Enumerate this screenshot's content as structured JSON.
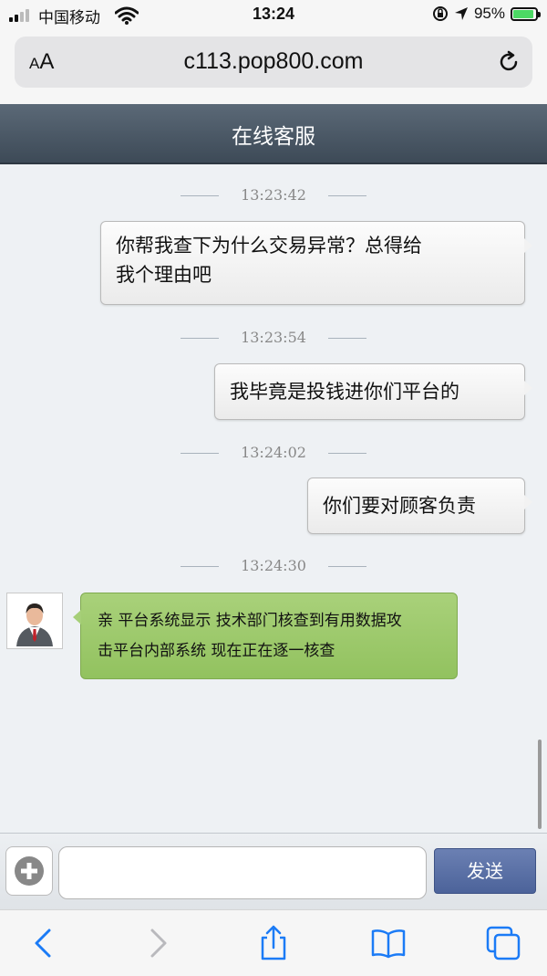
{
  "status_bar": {
    "carrier": "中国移动",
    "time": "13:24",
    "battery": "95%"
  },
  "browser": {
    "text_size_label_small": "A",
    "text_size_label_big": "A",
    "url": "c113.pop800.com"
  },
  "header": {
    "title": "在线客服"
  },
  "messages": [
    {
      "time": "13:23:42",
      "text_line1": "你帮我查下为什么交易异常？总得给",
      "text_line2": "我个理由吧"
    },
    {
      "time": "13:23:54",
      "text": "我毕竟是投钱进你们平台的"
    },
    {
      "time": "13:24:02",
      "text": "你们要对顾客负责"
    },
    {
      "time": "13:24:30",
      "text_line1": "亲 平台系统显示 技术部门核查到有用数据攻",
      "text_line2": "击平台内部系统 现在正在逐一核查"
    }
  ],
  "input": {
    "placeholder": "",
    "value": "",
    "send_label": "发送"
  },
  "colors": {
    "header": "#4a5764",
    "agent_bubble": "#9ec76d",
    "send_button": "#5a6fa6",
    "accent": "#1b7bf6"
  },
  "icons": [
    "signal-icon",
    "wifi-icon",
    "lock-rotation-icon",
    "location-icon",
    "battery-icon",
    "reload-icon",
    "avatar-icon",
    "plus-icon",
    "back-icon",
    "forward-icon",
    "share-icon",
    "bookmarks-icon",
    "tabs-icon"
  ]
}
